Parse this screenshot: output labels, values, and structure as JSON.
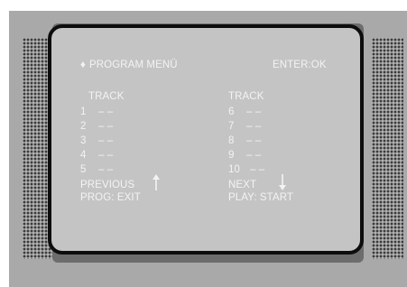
{
  "header": {
    "title_marker": "♦",
    "title": "PROGRAM MENÜ",
    "confirm_hint": "ENTER:OK"
  },
  "left_column": {
    "heading": "TRACK",
    "tracks": [
      {
        "number": "1",
        "value": "– –"
      },
      {
        "number": "2",
        "value": "– –"
      },
      {
        "number": "3",
        "value": "– –"
      },
      {
        "number": "4",
        "value": "– –"
      },
      {
        "number": "5",
        "value": "– –"
      }
    ],
    "previous_label": "PREVIOUS",
    "previous_icon": "up-arrow-icon",
    "prog_hint": "PROG: EXIT"
  },
  "right_column": {
    "heading": "TRACK",
    "tracks": [
      {
        "number": "6",
        "value": "– –"
      },
      {
        "number": "7",
        "value": "– –"
      },
      {
        "number": "8",
        "value": "– –"
      },
      {
        "number": "9",
        "value": "– –"
      },
      {
        "number": "10",
        "value": "– –"
      }
    ],
    "next_label": "NEXT",
    "next_icon": "down-arrow-icon",
    "play_hint": "PLAY: START"
  },
  "colors": {
    "device_body": "#a9a9a9",
    "screen": "#c4c4c4",
    "screen_frame": "#0d0d0d",
    "text": "#f3f3f3"
  }
}
